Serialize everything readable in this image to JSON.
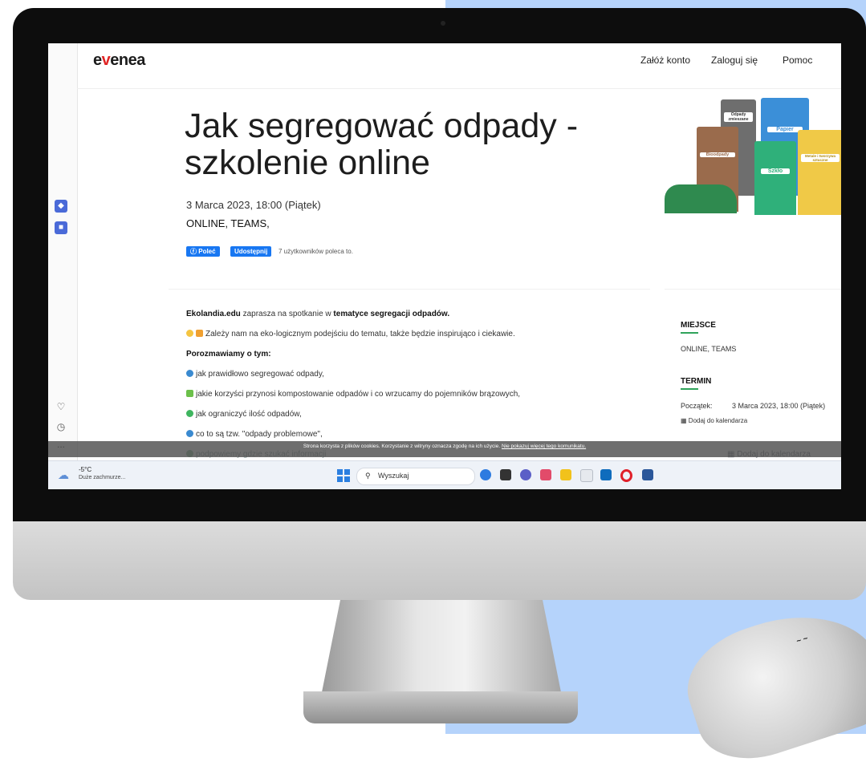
{
  "brand": {
    "logo_prefix": "e",
    "logo_v": "v",
    "logo_suffix": "enea"
  },
  "nav": {
    "signup": "Załóż konto",
    "login": "Zaloguj się",
    "help": "Pomoc"
  },
  "event": {
    "title": "Jak segregować odpady - szkolenie online",
    "date": "3 Marca 2023, 18:00 (Piątek)",
    "location": "ONLINE, TEAMS,"
  },
  "social": {
    "recommend": "Poleć",
    "share": "Udostępnij",
    "count_text": "7 użytkowników poleca to."
  },
  "bins": {
    "mixed": "Odpady zmieszane",
    "paper": "Papier",
    "bio": "Bioodpady",
    "glass": "Szkło",
    "metal": "Metale i tworzywa sztuczne"
  },
  "description": {
    "intro_brand": "Ekolandia.edu",
    "intro_mid": " zaprasza na spotkanie w ",
    "intro_topic": "tematyce segregacji odpadów.",
    "eco_line": "Zależy nam na eko-logicznym podejściu do tematu, także będzie inspirująco i ciekawie.",
    "talk_heading": "Porozmawiamy o tym:",
    "item1": "jak prawidłowo segregować odpady,",
    "item2": "jakie korzyści przynosi kompostowanie odpadów i co wrzucamy do pojemników brązowych,",
    "item3": "jak ograniczyć ilość odpadów,",
    "item4": "co to są tzw. \"odpady problemowe\",",
    "item5": "podpowiemy gdzie szukać informacji"
  },
  "sidebar_info": {
    "place_heading": "MIEJSCE",
    "place_value": "ONLINE, TEAMS",
    "term_heading": "TERMIN",
    "start_label": "Początek:",
    "start_value": "3 Marca 2023, 18:00 (Piątek)",
    "calendar_link": "Dodaj do kalendarza",
    "calendar_link_faded": "Dodaj do kalendarza"
  },
  "cookie_bar": {
    "text": "Strona korzysta z plików cookies. Korzystanie z witryny oznacza zgodę na ich użycie.",
    "dismiss": "Nie pokazuj więcej tego komunikatu."
  },
  "taskbar": {
    "temperature": "-5°C",
    "weather": "Duże zachmurze...",
    "search_placeholder": "Wyszukaj"
  },
  "browser_sidebar": {
    "more": "..."
  },
  "colors": {
    "accent_red": "#e02424",
    "facebook_blue": "#1877f2",
    "green_underline": "#2fa35a",
    "background_blue": "#b5d3fb"
  }
}
